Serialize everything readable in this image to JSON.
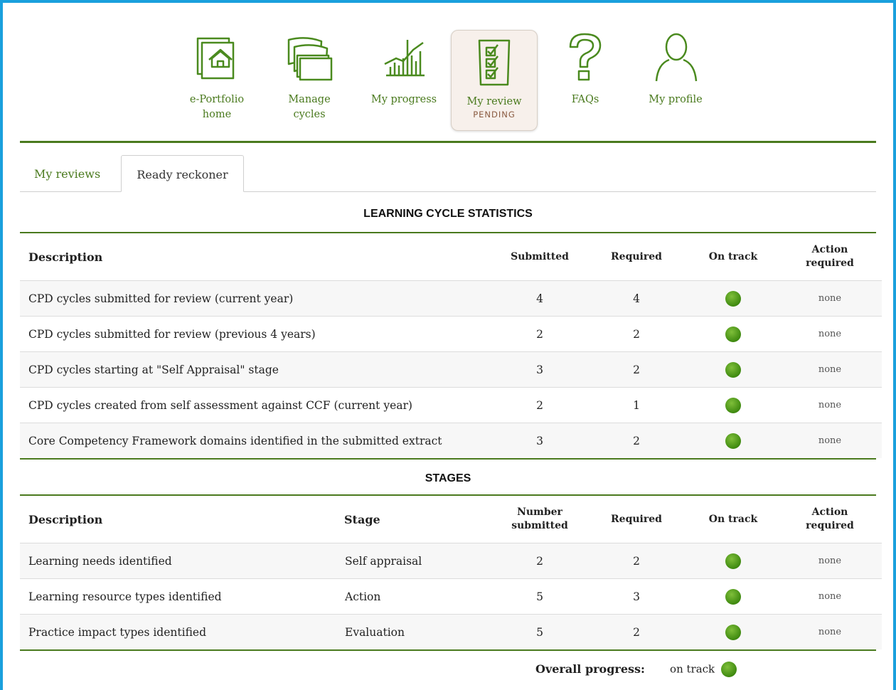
{
  "nav": {
    "items": [
      {
        "label": "e-Portfolio home",
        "icon": "home-folder-icon"
      },
      {
        "label": "Manage cycles",
        "icon": "cards-stack-icon"
      },
      {
        "label": "My progress",
        "icon": "progress-chart-icon"
      },
      {
        "label": "My review",
        "sub": "PENDING",
        "icon": "checklist-icon",
        "active": true
      },
      {
        "label": "FAQs",
        "icon": "question-mark-icon"
      },
      {
        "label": "My profile",
        "icon": "user-profile-icon"
      }
    ]
  },
  "tabs": [
    {
      "label": "My reviews",
      "active": false
    },
    {
      "label": "Ready reckoner",
      "active": true
    }
  ],
  "learning_cycle": {
    "title": "LEARNING CYCLE STATISTICS",
    "headers": {
      "description": "Description",
      "submitted": "Submitted",
      "required": "Required",
      "on_track": "On track",
      "action": "Action required"
    },
    "rows": [
      {
        "description": "CPD cycles submitted for review (current year)",
        "submitted": "4",
        "required": "4",
        "on_track": true,
        "action": "none"
      },
      {
        "description": "CPD cycles submitted for review (previous 4 years)",
        "submitted": "2",
        "required": "2",
        "on_track": true,
        "action": "none"
      },
      {
        "description": "CPD cycles starting at \"Self Appraisal\" stage",
        "submitted": "3",
        "required": "2",
        "on_track": true,
        "action": "none"
      },
      {
        "description": "CPD cycles created from self assessment against CCF (current year)",
        "submitted": "2",
        "required": "1",
        "on_track": true,
        "action": "none"
      },
      {
        "description": "Core Competency Framework domains identified in the submitted extract",
        "submitted": "3",
        "required": "2",
        "on_track": true,
        "action": "none"
      }
    ]
  },
  "stages": {
    "title": "STAGES",
    "headers": {
      "description": "Description",
      "stage": "Stage",
      "number_submitted": "Number submitted",
      "required": "Required",
      "on_track": "On track",
      "action": "Action required"
    },
    "rows": [
      {
        "description": "Learning needs identified",
        "stage": "Self appraisal",
        "submitted": "2",
        "required": "2",
        "on_track": true,
        "action": "none"
      },
      {
        "description": "Learning resource types identified",
        "stage": "Action",
        "submitted": "5",
        "required": "3",
        "on_track": true,
        "action": "none"
      },
      {
        "description": "Practice impact types identified",
        "stage": "Evaluation",
        "submitted": "5",
        "required": "2",
        "on_track": true,
        "action": "none"
      }
    ]
  },
  "overall": {
    "label": "Overall progress:",
    "value": "on track"
  },
  "colors": {
    "accent": "#4a7a1e",
    "frame": "#1aa0dd",
    "status_ok": "#4c9a1a"
  }
}
